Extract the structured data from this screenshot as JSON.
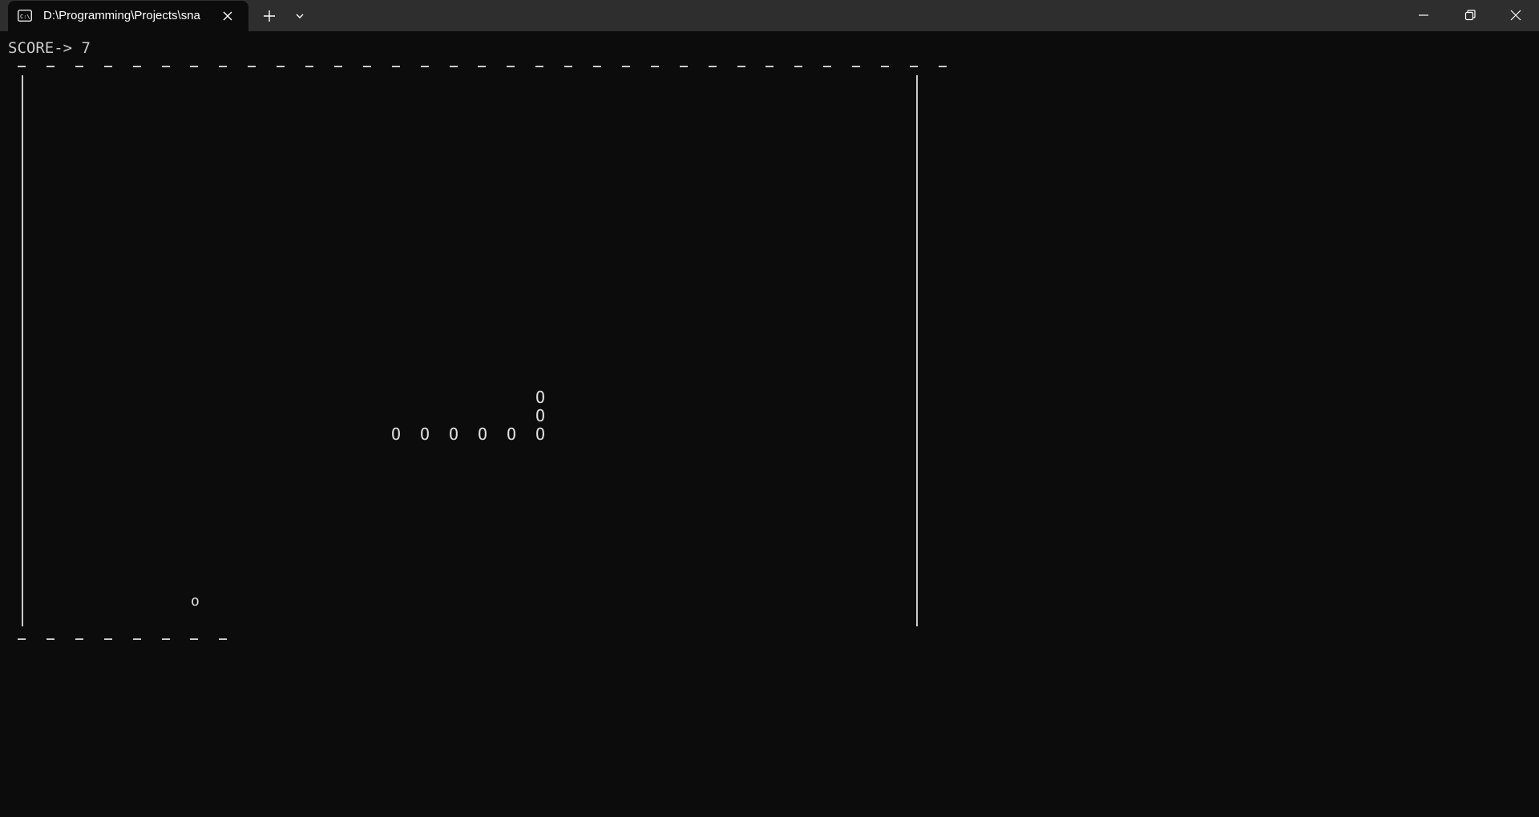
{
  "window": {
    "tab_title": "D:\\Programming\\Projects\\sna",
    "tab_icon": "terminal-icon",
    "caption_buttons": [
      "minimize-icon",
      "maximize-icon",
      "close-icon"
    ]
  },
  "game": {
    "score_label": "SCORE-> 7",
    "score": 7,
    "snake_glyph": "O",
    "food_glyph": "o",
    "border_glyphs": {
      "horizontal": "_",
      "vertical": "|"
    },
    "colors": {
      "background": "#0c0c0c",
      "text": "#cccccc",
      "titlebar": "#2e2e2e"
    }
  }
}
